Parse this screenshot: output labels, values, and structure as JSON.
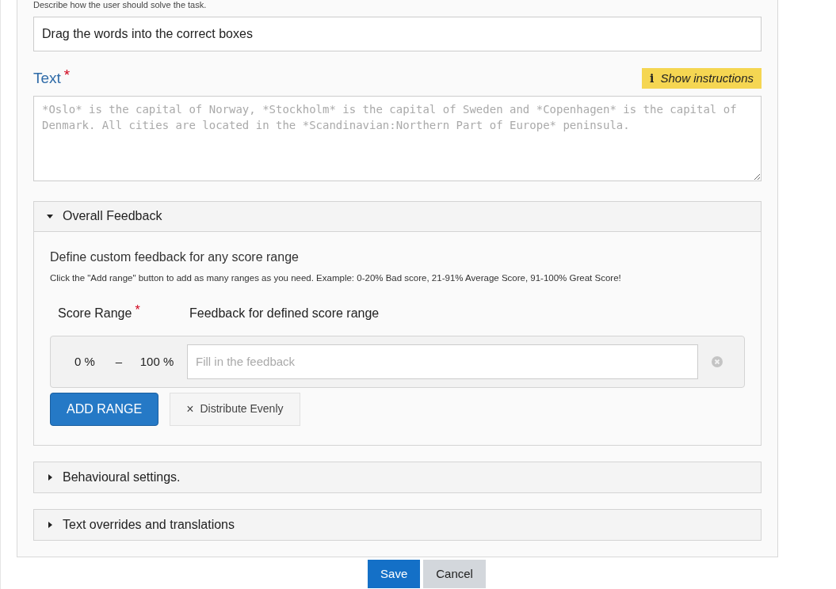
{
  "task_description": {
    "hint": "Describe how the user should solve the task.",
    "value": "Drag the words into the correct boxes"
  },
  "text_field": {
    "label": "Text",
    "required_mark": "*",
    "instructions_button": {
      "icon": "i",
      "label": "Show instructions"
    },
    "placeholder": "*Oslo* is the capital of Norway, *Stockholm* is the capital of Sweden and *Copenhagen* is the capital of Denmark. All cities are located in the *Scandinavian:Northern Part of Europe* peninsula."
  },
  "sections": [
    {
      "title": "Overall Feedback",
      "expanded": true,
      "heading": "Define custom feedback for any score range",
      "description": "Click the \"Add range\" button to add as many ranges as you need. Example: 0-20% Bad score, 21-91% Average Score, 91-100% Great Score!",
      "columns": [
        {
          "label": "Score Range",
          "required_mark": "*"
        },
        {
          "label": "Feedback for defined score range"
        }
      ],
      "ranges": [
        {
          "from": "0 %",
          "separator": "–",
          "to": "100 %",
          "placeholder": "Fill in the feedback"
        }
      ],
      "buttons": [
        {
          "kind": "primary",
          "label": "ADD RANGE"
        },
        {
          "kind": "secondary",
          "icon": "×",
          "label": "Distribute Evenly"
        }
      ]
    },
    {
      "title": "Behavioural settings.",
      "expanded": false
    },
    {
      "title": "Text overrides and translations",
      "expanded": false
    }
  ],
  "footer_buttons": [
    {
      "kind": "primary",
      "label": "Save"
    },
    {
      "kind": "secondary",
      "label": "Cancel"
    }
  ]
}
